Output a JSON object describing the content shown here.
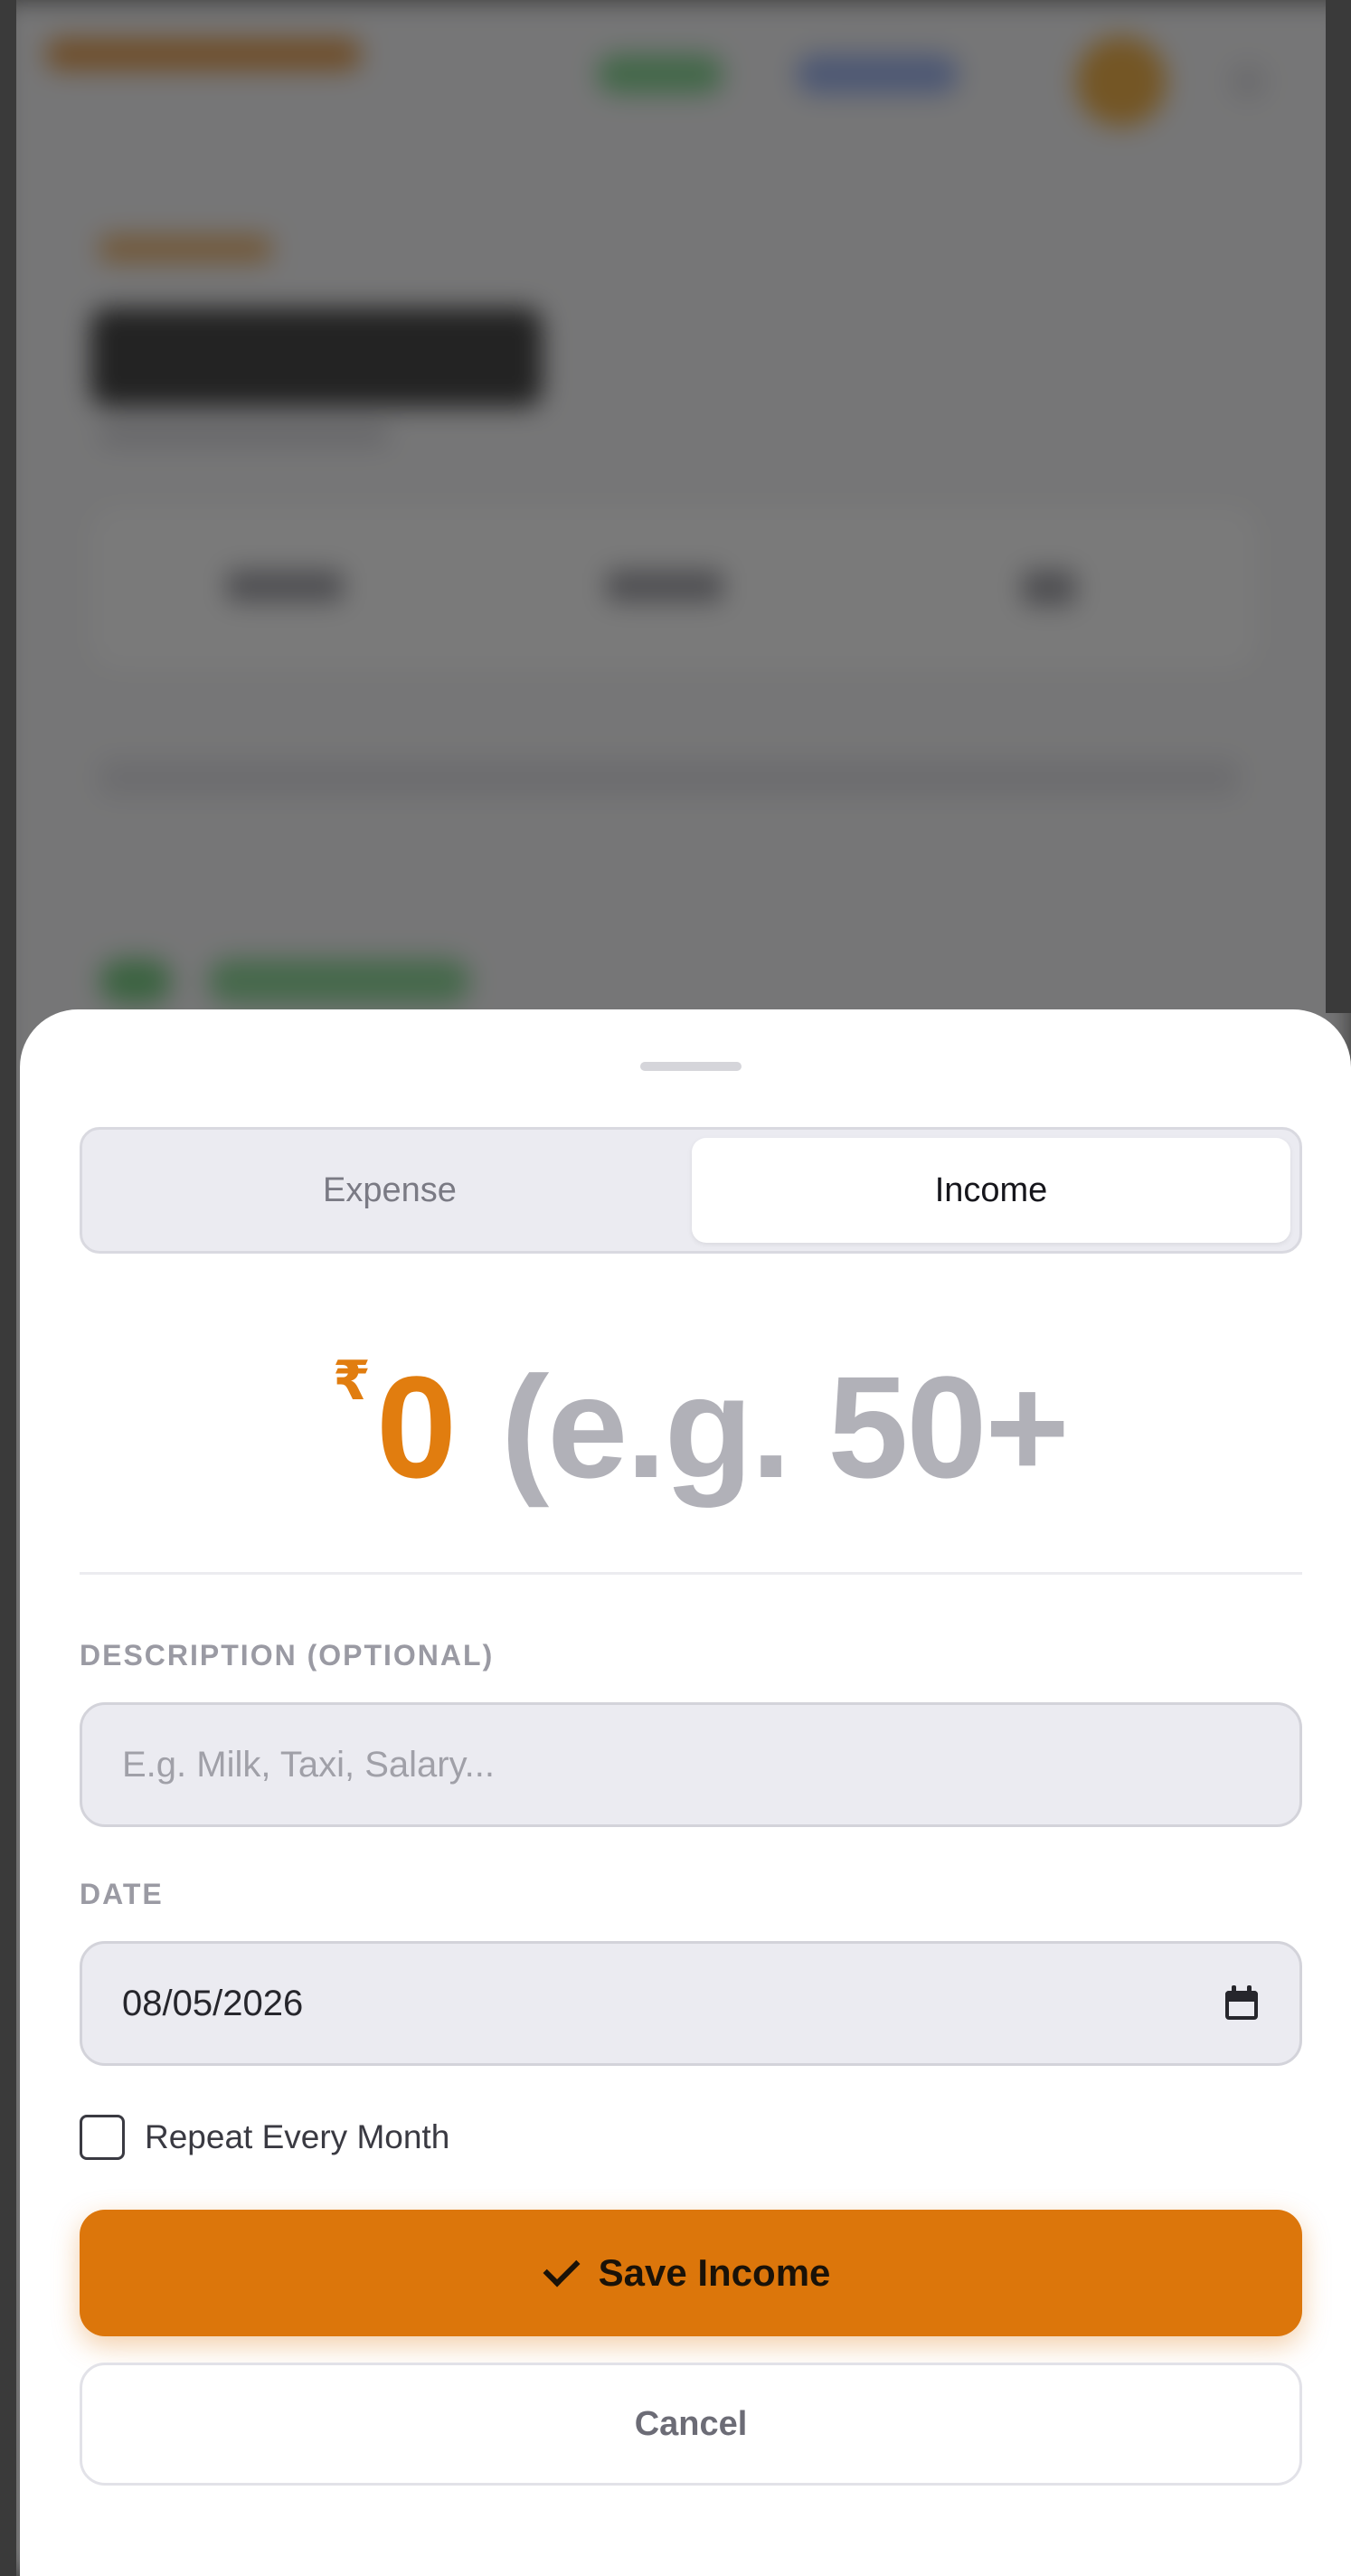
{
  "background_app": {
    "description_hidden": true
  },
  "sheet": {
    "tabs": [
      {
        "label": "Expense",
        "active": false
      },
      {
        "label": "Income",
        "active": true
      }
    ],
    "amount": {
      "currency_symbol": "₹",
      "value": "0",
      "placeholder": "(e.g. 50+"
    },
    "description": {
      "label": "DESCRIPTION (OPTIONAL)",
      "placeholder": "E.g. Milk, Taxi, Salary..."
    },
    "date": {
      "label": "DATE",
      "value": "08/05/2026"
    },
    "repeat": {
      "label": "Repeat Every Month",
      "checked": false
    },
    "save_label": "Save Income",
    "cancel_label": "Cancel",
    "colors": {
      "accent": "#dc760b",
      "amount": "#e17d0f"
    }
  }
}
